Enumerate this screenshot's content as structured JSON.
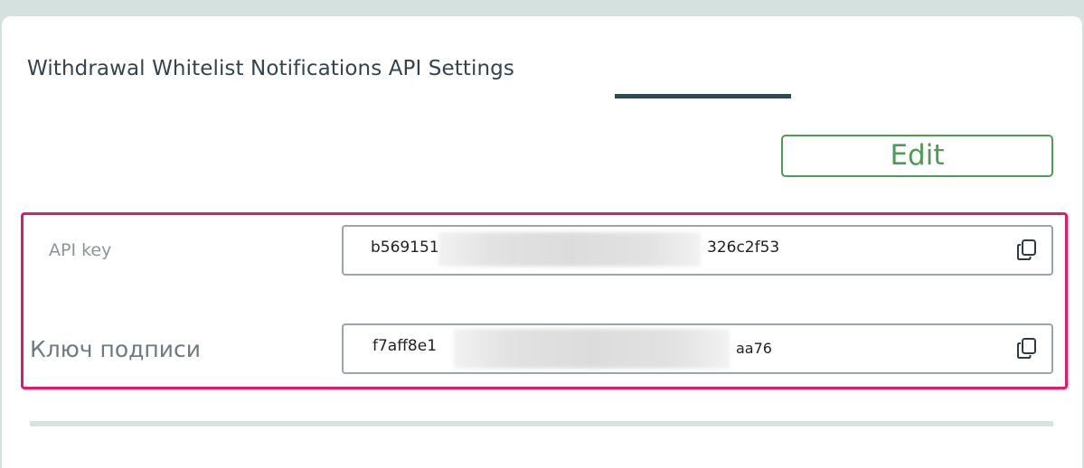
{
  "settings": {
    "title": "Withdrawal Whitelist Notifications API Settings",
    "edit_label": "Edit"
  },
  "api_key": {
    "label": "API key",
    "value_start": "b569151",
    "value_end": "326c2f53"
  },
  "signature_key": {
    "label": "Ключ подписи",
    "value_start": "f7aff8e1",
    "value_end": "aa76"
  },
  "icons": {
    "copy": "copy-icon"
  },
  "colors": {
    "accent_green": "#4f9a57",
    "highlight": "#e3196b",
    "tab_underline": "#2e4c4f"
  }
}
